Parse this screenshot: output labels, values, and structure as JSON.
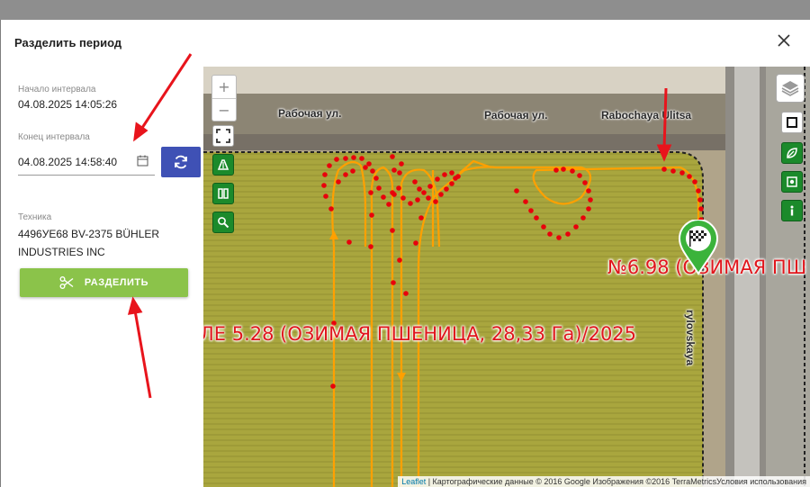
{
  "dialog": {
    "title": "Разделить период",
    "interval_start_label": "Начало интервала",
    "interval_start_value": "04.08.2025 14:05:26",
    "interval_end_label": "Конец интервала",
    "interval_end_value": "04.08.2025 14:58:40",
    "machine_label": "Техника",
    "machine_value": "4496УЕ68 BV-2375 BÜHLER INDUSTRIES INC",
    "split_button_label": "РАЗДЕЛИТЬ"
  },
  "icons": {
    "close": "close-icon",
    "calendar": "calendar-icon",
    "refresh": "refresh-icon",
    "split": "scissors-icon",
    "zoom_in": "plus-icon",
    "zoom_out": "minus-icon",
    "fullscreen": "fullscreen-icon",
    "ruler": "ruler-icon",
    "columns": "columns-icon",
    "search": "search-icon",
    "layers": "layers-icon",
    "square": "square-icon",
    "leaf": "leaf-icon",
    "photo": "photo-icon",
    "info": "info-icon",
    "finish": "finish-flag-icon"
  },
  "map": {
    "zoom_in_label": "+",
    "zoom_out_label": "−",
    "streets": [
      "Рабочая ул.",
      "Рабочая ул.",
      "Rabochaya Ulitsa",
      "rylovskaya"
    ],
    "field_label_left": "ЛЕ 5.28 (ОЗИМАЯ ПШЕНИЦА, 28,33 Га)/2025",
    "field_label_right": "№6.98 (ОЗИМАЯ ПШ",
    "attribution_link": "Leaflet",
    "attribution_text": " | Картографические данные © 2016 Google Изображения ©2016 TerraMetricsУсловия использования"
  },
  "colors": {
    "accent_blue": "#3f51b5",
    "split_green": "#8bc34a",
    "control_green": "#1b8a2b",
    "track_orange": "#ffa000",
    "point_red": "#e8000b",
    "field_label_red": "#e0161c",
    "field_yellow": "#a7a43c"
  }
}
